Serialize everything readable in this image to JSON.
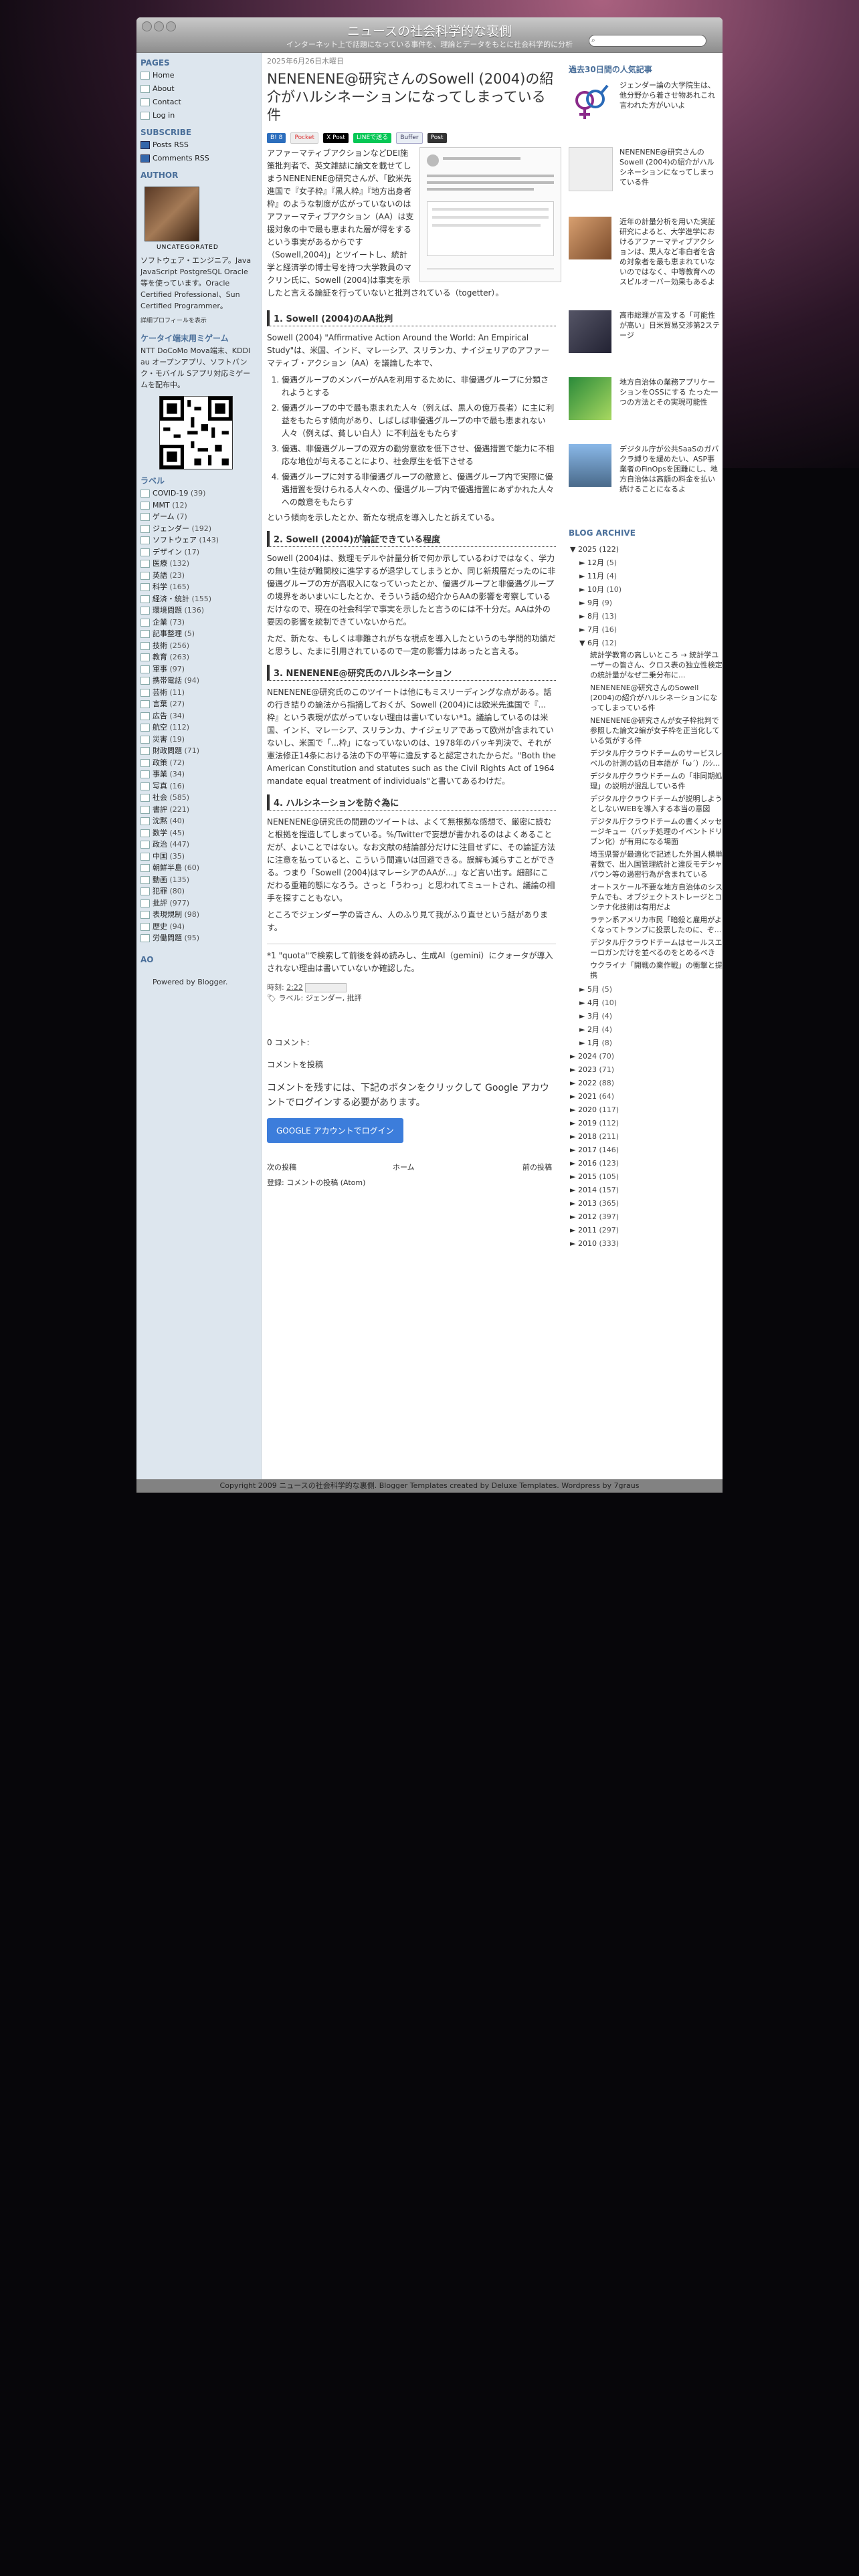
{
  "header": {
    "title": "ニュースの社会科学的な裏側",
    "desc": "インターネット上で話題になっている事件を、理論とデータをもとに社会科学的に分析"
  },
  "left": {
    "pages_h": "PAGES",
    "pages": [
      "Home",
      "About",
      "Contact",
      "Log in"
    ],
    "subscribe_h": "SUBSCRIBE",
    "feeds": [
      "Posts RSS",
      "Comments RSS"
    ],
    "author_h": "AUTHOR",
    "uncat": "UNCATEGORATED",
    "bio": "ソフトウェア・エンジニア。Java JavaScript PostgreSQL Oracle 等を使っています。Oracle Certified Professional、Sun Certified Programmer。",
    "profile_link": "詳細プロフィールを表示",
    "app_h": "ケータイ端末用ミゲーム",
    "app_text": "NTT DoCoMo Mova端末、KDDI au オープンアプリ、ソフトバンク・モバイル Sアプリ対応ミゲームを配布中。",
    "labels_h": "ラベル",
    "labels": [
      [
        "COVID-19",
        "(39)"
      ],
      [
        "MMT",
        "(12)"
      ],
      [
        "ゲーム",
        "(7)"
      ],
      [
        "ジェンダー",
        "(192)"
      ],
      [
        "ソフトウェア",
        "(143)"
      ],
      [
        "デザイン",
        "(17)"
      ],
      [
        "医療",
        "(132)"
      ],
      [
        "英語",
        "(23)"
      ],
      [
        "科学",
        "(165)"
      ],
      [
        "経済・統計",
        "(155)"
      ],
      [
        "環境問題",
        "(136)"
      ],
      [
        "企業",
        "(73)"
      ],
      [
        "記事整理",
        "(5)"
      ],
      [
        "技術",
        "(256)"
      ],
      [
        "教育",
        "(263)"
      ],
      [
        "軍事",
        "(97)"
      ],
      [
        "携帯電話",
        "(94)"
      ],
      [
        "芸術",
        "(11)"
      ],
      [
        "言葉",
        "(27)"
      ],
      [
        "広告",
        "(34)"
      ],
      [
        "航空",
        "(112)"
      ],
      [
        "災害",
        "(19)"
      ],
      [
        "財政問題",
        "(71)"
      ],
      [
        "政策",
        "(72)"
      ],
      [
        "事業",
        "(34)"
      ],
      [
        "写真",
        "(16)"
      ],
      [
        "社会",
        "(585)"
      ],
      [
        "書評",
        "(221)"
      ],
      [
        "沈黙",
        "(40)"
      ],
      [
        "数学",
        "(45)"
      ],
      [
        "政治",
        "(447)"
      ],
      [
        "中国",
        "(35)"
      ],
      [
        "朝鮮半島",
        "(60)"
      ],
      [
        "動画",
        "(135)"
      ],
      [
        "犯罪",
        "(80)"
      ],
      [
        "批評",
        "(977)"
      ],
      [
        "表現規制",
        "(98)"
      ],
      [
        "歴史",
        "(94)"
      ],
      [
        "労働問題",
        "(95)"
      ]
    ],
    "ao": "AO",
    "powered": "Powered by Blogger."
  },
  "post": {
    "date": "2025年6月26日木曜日",
    "title": "NENENENE@研究さんのSowell (2004)の紹介がハルシネーションになってしまっている件",
    "social": [
      "B! 8",
      "Pocket",
      "X Post",
      "LINEで送る",
      "Buffer",
      "Post"
    ],
    "p1": "アファーマティブアクションなどDEI施策批判者で、英文雑誌に論文を載せてしまうNENENENE@研究さんが、「欧米先進国で『女子枠』『黒人枠』『地方出身者枠』のような制度が広がっていないのはアファーマティブアクション（AA）は支援対象の中で最も恵まれた層が得をするという事実があるからです（Sowell,2004)」とツイートし、統計学と経済学の博士号を持つ大学教員のマクリン氏に、Sowell (2004)は事実を示したと言える論証を行っていないと批判されている（togetter）。",
    "h1": "1. Sowell (2004)のAA批判",
    "p2": "Sowell (2004) \"Affirmative Action Around the World: An Empirical Study\"は、米国、インド、マレーシア、スリランカ、ナイジェリアのアファーマティブ・アクション（AA）を議論した本で、",
    "list": [
      "優遇グループのメンバーがAAを利用するために、非優遇グループに分類されようとする",
      "優遇グループの中で最も恵まれた人々（例えば、黒人の億万長者）に主に利益をもたらす傾向があり、しばしば非優遇グループの中で最も恵まれない人々（例えば、貧しい白人）に不利益をもたらす",
      "優遇、非優遇グループの双方の勤労意欲を低下させ、優遇措置で能力に不相応な地位が与えることにより、社会厚生を低下させる",
      "優遇グループに対する非優遇グループの敵意と、優遇グループ内で実際に優遇措置を受けられる人々への、優遇グループ内で優遇措置にあずかれた人々への敵意をもたらす"
    ],
    "p3": "という傾向を示したとか、新たな視点を導入したと訴えている。",
    "h2": "2. Sowell (2004)が論証できている程度",
    "p4": "Sowell (2004)は、数理モデルや計量分析で何か示しているわけではなく、学力の無い生徒が難関校に進学するが退学してしまうとか、同じ新規層だったのに非優遇グループの方が高収入になっていったとか、優遇グループと非優遇グループの境界をあいまいにしたとか、そういう話の紹介からAAの影響を考察しているだけなので、現在の社会科学で事実を示したと言うのには不十分だ。AAは外の要因の影響を統制できていないからだ。",
    "p5": "ただ、新たな、もしくは非難されがちな視点を導入したというのも学問的功績だと思うし、たまに引用されているので一定の影響力はあったと言える。",
    "h3": "3. NENENENE@研究氏のハルシネーション",
    "p6": "NENENENE@研究氏のこのツイートは他にもミスリーディングな点がある。話の行き詰りの論法から指摘しておくが、Sowell (2004)には欧米先進国で『...枠』という表現が広がっていない理由は書いていない*1。議論しているのは米国、インド、マレーシア、スリランカ、ナイジェリアであって欧州が含まれていないし、米国で「...枠」になっていないのは、1978年のバッキ判決で、それが憲法修正14条における法の下の平等に違反すると認定されたからだ。\"Both the American Constitution and statutes such as the Civil Rights Act of 1964 mandate equal treatment of individuals\"と書いてあるわけだ。",
    "h4": "4. ハルシネーションを防ぐ為に",
    "p7": "NENENENE@研究氏の問題のツイートは、よくて無根拠な感想で、厳密に読むと根拠を捏造してしまっている。%/Twitterで妄想が書かれるのはよくあることだが、よいことではない。なお文献の結論部分だけに注目せずに、その論証方法に注意を払っていると、こういう間違いは回避できる。誤解も減らすことができる。つまり「Sowell (2004)はマレーシアのAAが...」など言い出す。細部にこだわる重箱的態になろう。さっと「うわっ」と思われてミュートされ、議論の相手を探すこともない。",
    "p8": "ところでジェンダー学の皆さん、人のふり見て我がふり直せという話があります。",
    "fn": "*1 \"quota\"で検索して前後を斜め読みし、生成AI（gemini）にクォータが導入されない理由は書いていないか確認した。",
    "meta_time": "時刻:",
    "time": "2:22",
    "meta_labels": "ラベル:",
    "label_links": "ジェンダー, 批評",
    "comments": "0 コメント:",
    "comments_head": "コメントを投稿",
    "comment_msg": "コメントを残すには、下記のボタンをクリックして Google アカウントでログインする必要があります。",
    "google_btn": "GOOGLE アカウントでログイン",
    "nav_next": "次の投稿",
    "nav_home": "ホーム",
    "nav_prev": "前の投稿",
    "subscribe": "登録: コメントの投稿 (Atom)"
  },
  "right": {
    "popular_h": "過去30日間の人気記事",
    "popular": [
      "ジェンダー論の大学院生は、他分野から着させ物あれこれ言われた方がいいよ",
      "NENENENE@研究さんのSowell (2004)の紹介がハルシネーションになってしまっている件",
      "近年の計量分析を用いた実証研究によると、大学進学におけるアファーマティブアクションは、黒人など非白者を含め対象者を最も恵まれていないのではなく、中等教育へのスピルオーバー効果もあるよ",
      "高市総理が言及する「可能性が高い」日米貿易交渉第2ステージ",
      "地方自治体の業務アプリケーションをOSSにする たった一つの方法とその実現可能性",
      "デジタル庁が公共SaaSのガバクラ縛りを緩めたい、ASP事業者のFinOpsを困難にし、地方自治体は高額の料金を払い続けることになるよ"
    ],
    "archive_h": "BLOG ARCHIVE",
    "y2025": [
      "▼",
      "2025",
      "(122)"
    ],
    "months_top": [
      [
        "12月",
        "(5)"
      ],
      [
        "11月",
        "(4)"
      ],
      [
        "10月",
        "(10)"
      ],
      [
        "9月",
        "(9)"
      ],
      [
        "8月",
        "(13)"
      ],
      [
        "7月",
        "(16)"
      ]
    ],
    "june": [
      "▼",
      "6月",
      "(12)"
    ],
    "june_posts": [
      "統計学教育の高しいところ → 統計学ユーザーの皆さん、クロス表の独立性検定の統計量がなぜ二乗分布に...",
      "NENENENE@研究さんのSowell (2004)の紹介がハルシネーションになってしまっている件",
      "NENENENE@研究さんが女子枠批判で参照した論文2編が女子枠を正当化している気がする件",
      "デジタル庁クラウドチームのサービスレベルの計測の話の日本語が「ω´）/ｼｼ…",
      "デジタル庁クラウドチームの「非同期処理」の説明が混乱している件",
      "デジタル庁クラウドチームが説明しようとしないWEBを導入する本当の意図",
      "デジタル庁クラウドチームの書くメッセージキュー（バッチ処理のイベントドリブン化）が有用になる場面",
      "埼玉県警が最適化で記述した外国人横単者数で、出入国管理統計と違反モデシャパウン等の過密行為が含まれている",
      "オートスケール不要な地方自治体のシステムでも、オブジェクトストレージとコンテナ化技術は有用だよ",
      "ラテン系アメリカ市民「暗殺と雇用がよくなってトランプに投票したのに、ぞ...",
      "デジタル庁クラウドチームはセールスエーロガンだけを並べるのをとめるべき",
      "ウクライナ「開戦の業作戦」の衝撃と提携"
    ],
    "months_bottom": [
      [
        "5月",
        "(5)"
      ],
      [
        "4月",
        "(10)"
      ],
      [
        "3月",
        "(4)"
      ],
      [
        "2月",
        "(4)"
      ],
      [
        "1月",
        "(8)"
      ]
    ],
    "years": [
      [
        "2024",
        "(70)"
      ],
      [
        "2023",
        "(71)"
      ],
      [
        "2022",
        "(88)"
      ],
      [
        "2021",
        "(64)"
      ],
      [
        "2020",
        "(117)"
      ],
      [
        "2019",
        "(112)"
      ],
      [
        "2018",
        "(211)"
      ],
      [
        "2017",
        "(146)"
      ],
      [
        "2016",
        "(123)"
      ],
      [
        "2015",
        "(105)"
      ],
      [
        "2014",
        "(157)"
      ],
      [
        "2013",
        "(365)"
      ],
      [
        "2012",
        "(397)"
      ],
      [
        "2011",
        "(297)"
      ],
      [
        "2010",
        "(333)"
      ]
    ]
  },
  "footer": {
    "text": "Copyright 2009 ニュースの社会科学的な裏側. Blogger Templates created by Deluxe Templates. Wordpress by 7graus"
  },
  "search": {
    "placeholder": ""
  }
}
